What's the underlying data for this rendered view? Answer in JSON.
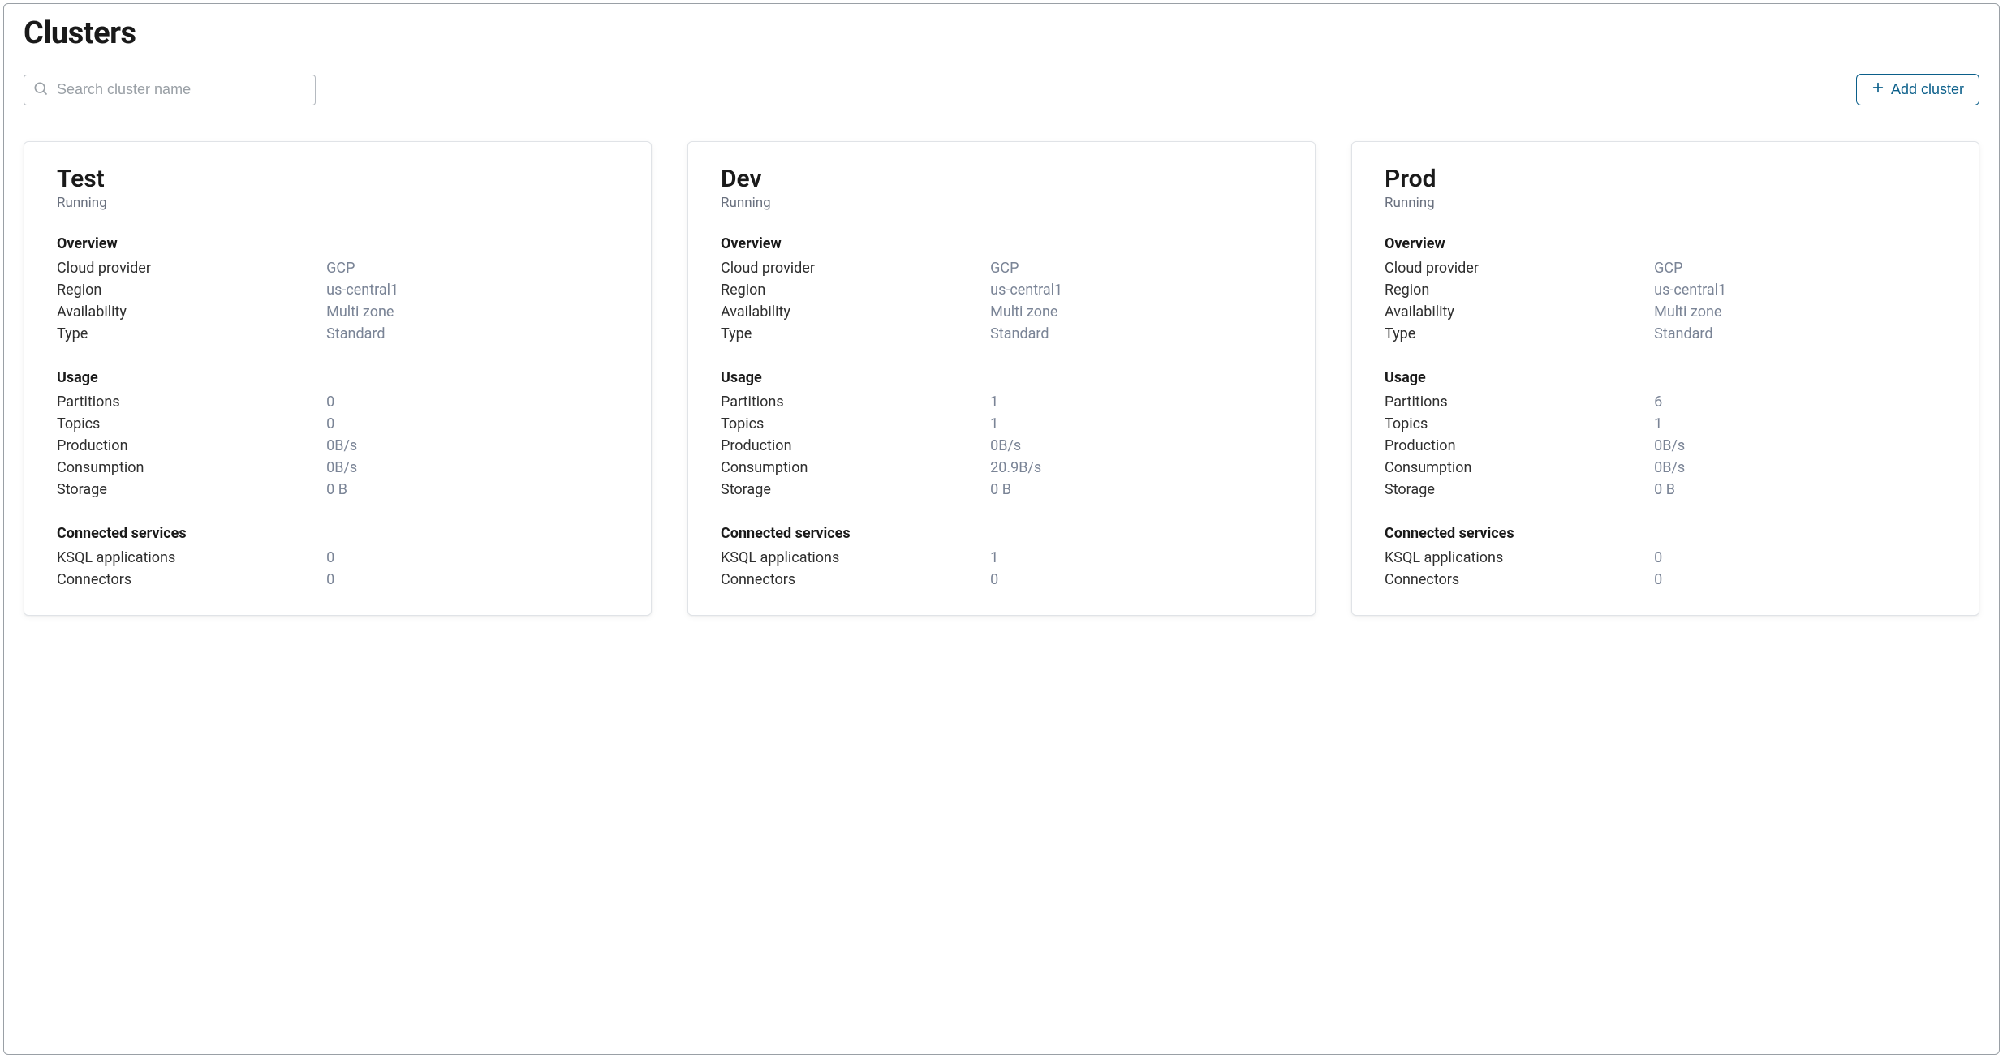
{
  "page": {
    "title": "Clusters"
  },
  "toolbar": {
    "search_placeholder": "Search cluster name",
    "add_cluster_label": "Add cluster"
  },
  "labels": {
    "overview": "Overview",
    "cloud_provider": "Cloud provider",
    "region": "Region",
    "availability": "Availability",
    "type": "Type",
    "usage": "Usage",
    "partitions": "Partitions",
    "topics": "Topics",
    "production": "Production",
    "consumption": "Consumption",
    "storage": "Storage",
    "connected_services": "Connected services",
    "ksql_applications": "KSQL applications",
    "connectors": "Connectors"
  },
  "clusters": [
    {
      "name": "Test",
      "status": "Running",
      "overview": {
        "cloud_provider": "GCP",
        "region": "us-central1",
        "availability": "Multi zone",
        "type": "Standard"
      },
      "usage": {
        "partitions": "0",
        "topics": "0",
        "production": "0B/s",
        "consumption": "0B/s",
        "storage": "0 B"
      },
      "connected_services": {
        "ksql_applications": "0",
        "connectors": "0"
      }
    },
    {
      "name": "Dev",
      "status": "Running",
      "overview": {
        "cloud_provider": "GCP",
        "region": "us-central1",
        "availability": "Multi zone",
        "type": "Standard"
      },
      "usage": {
        "partitions": "1",
        "topics": "1",
        "production": "0B/s",
        "consumption": "20.9B/s",
        "storage": "0 B"
      },
      "connected_services": {
        "ksql_applications": "1",
        "connectors": "0"
      }
    },
    {
      "name": "Prod",
      "status": "Running",
      "overview": {
        "cloud_provider": "GCP",
        "region": "us-central1",
        "availability": "Multi zone",
        "type": "Standard"
      },
      "usage": {
        "partitions": "6",
        "topics": "1",
        "production": "0B/s",
        "consumption": "0B/s",
        "storage": "0 B"
      },
      "connected_services": {
        "ksql_applications": "0",
        "connectors": "0"
      }
    }
  ]
}
